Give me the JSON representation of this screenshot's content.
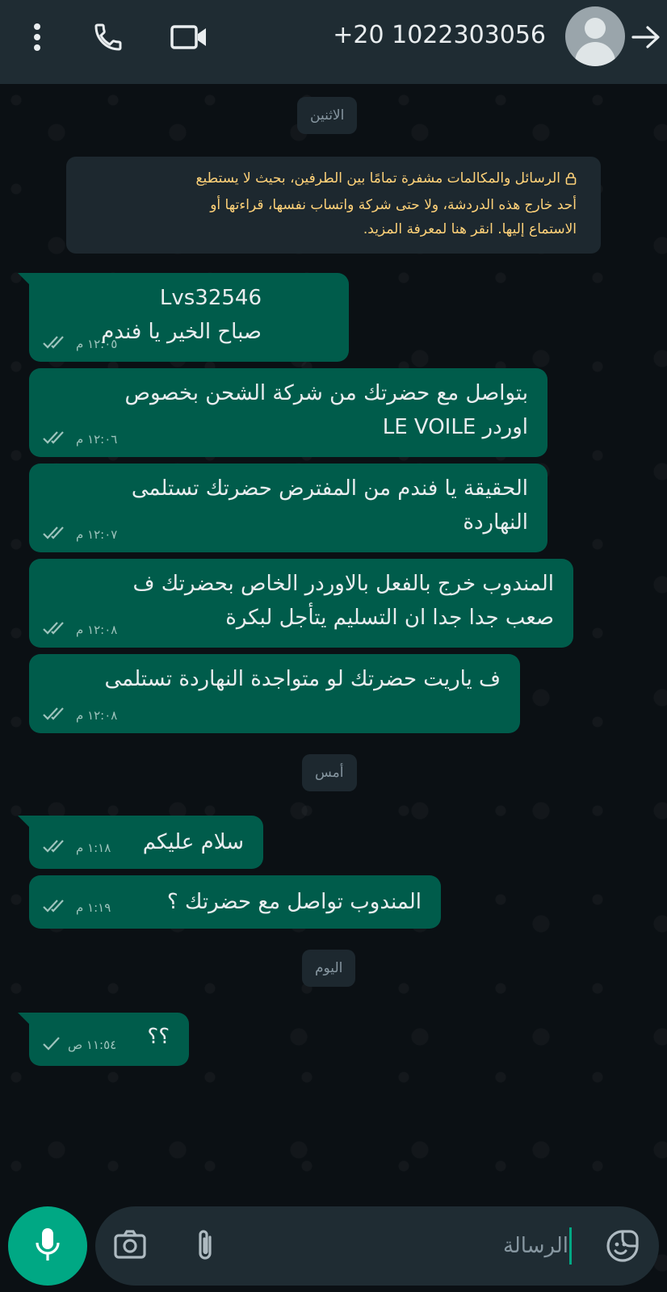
{
  "header": {
    "contact_number": "+20 1022303056",
    "icons": [
      "back-arrow-icon",
      "avatar",
      "video-call-icon",
      "voice-call-icon",
      "more-options-icon"
    ]
  },
  "date_chips": {
    "monday": "الاثنين",
    "yesterday": "أمس",
    "today": "اليوم"
  },
  "encryption_notice": {
    "line1": "الرسائل والمكالمات مشفرة تمامًا بين الطرفين، بحيث لا يستطيع",
    "line2": "أحد خارج هذه الدردشة، ولا حتى شركة واتساب نفسها، قراءتها أو",
    "line3": "الاستماع إليها. انقر هنا لمعرفة المزيد."
  },
  "messages": [
    {
      "line1": "Lvs32546",
      "line2": "صباح الخير يا فندم",
      "time": "١٢:٠٥ م",
      "status": "sent"
    },
    {
      "line1": "بتواصل مع حضرتك من شركة الشحن بخصوص",
      "line2_ar": "اوردر",
      "line2_en": "LE VOILE",
      "time": "١٢:٠٦ م",
      "status": "sent"
    },
    {
      "line1": "الحقيقة يا فندم من المفترض حضرتك تستلمى",
      "line2": "النهاردة",
      "time": "١٢:٠٧ م",
      "status": "sent"
    },
    {
      "line1": "المندوب خرج بالفعل بالاوردر الخاص بحضرتك ف",
      "line2": "صعب جدا جدا ان التسليم يتأجل لبكرة",
      "time": "١٢:٠٨ م",
      "status": "sent"
    },
    {
      "line1": "ف ياريت حضرتك لو متواجدة النهاردة تستلمى",
      "time": "١٢:٠٨ م",
      "status": "sent"
    },
    {
      "line1": "سلام عليكم",
      "time": "١:١٨ م",
      "status": "sent"
    },
    {
      "line1": "المندوب تواصل مع حضرتك ؟",
      "time": "١:١٩ م",
      "status": "sent"
    },
    {
      "line1": "؟؟",
      "time": "١١:٥٤ ص",
      "status": "single"
    }
  ],
  "input": {
    "placeholder": "الرسالة"
  },
  "colors": {
    "bubble": "#005c4b",
    "header": "#1f2c33",
    "background": "#0b1014",
    "accent": "#00a884",
    "notice_text": "#ffd279"
  }
}
